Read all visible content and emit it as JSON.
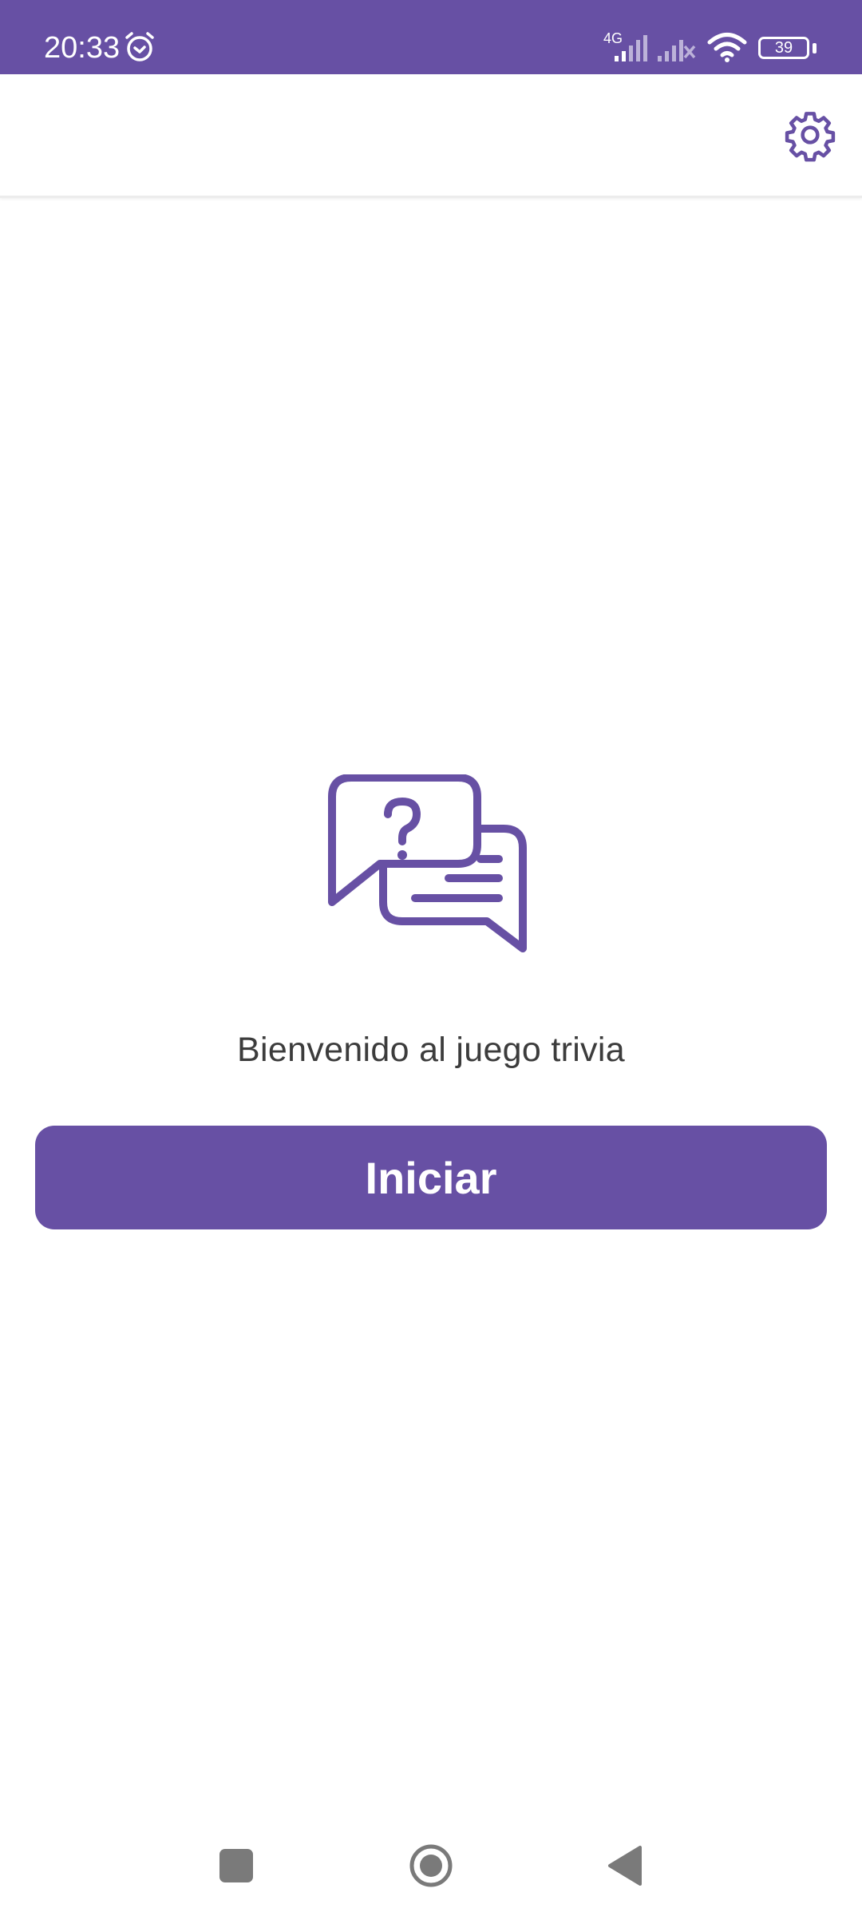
{
  "status_bar": {
    "time": "20:33",
    "network_label": "4G",
    "battery_level": "39",
    "icons": [
      "alarm-icon",
      "signal-icon",
      "signal-off-icon",
      "wifi-icon",
      "battery-icon"
    ]
  },
  "app_bar": {
    "settings_icon": "gear-icon"
  },
  "main": {
    "hero_icon": "question-chat-bubbles-icon",
    "welcome_text": "Bienvenido al juego trivia",
    "start_button_label": "Iniciar"
  },
  "nav_bar": {
    "icons": [
      "recents-square-icon",
      "home-circle-icon",
      "back-triangle-icon"
    ]
  },
  "colors": {
    "primary": "#6750a4",
    "text": "#3c3c3c",
    "background": "#ffffff",
    "nav_icon": "#7a7a7a"
  }
}
